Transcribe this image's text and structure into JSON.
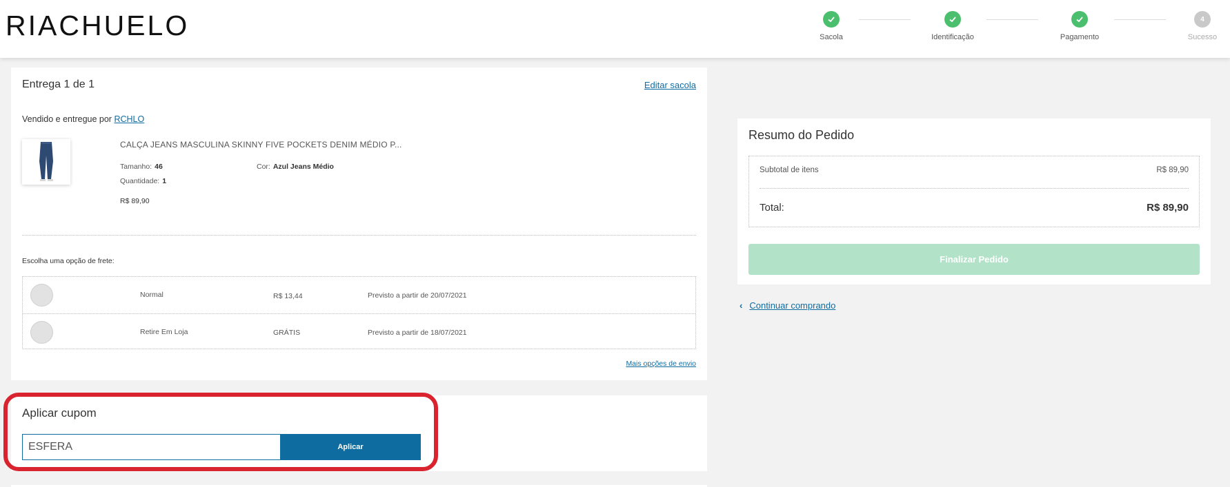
{
  "header": {
    "logo": "RIACHUELO",
    "steps": [
      {
        "label": "Sacola",
        "state": "done"
      },
      {
        "label": "Identificação",
        "state": "done"
      },
      {
        "label": "Pagamento",
        "state": "done"
      },
      {
        "label": "Sucesso",
        "state": "pending",
        "number": "4"
      }
    ]
  },
  "delivery": {
    "title": "Entrega 1 de 1",
    "edit_link": "Editar sacola",
    "seller_prefix": "Vendido e entregue por",
    "seller_link": "RCHLO",
    "product": {
      "name": "CALÇA JEANS MASCULINA SKINNY FIVE POCKETS DENIM MÉDIO P...",
      "size_label": "Tamanho:",
      "size_value": "46",
      "color_label": "Cor:",
      "color_value": "Azul Jeans Médio",
      "qty_label": "Quantidade:",
      "qty_value": "1",
      "price": "R$ 89,90"
    },
    "shipping_label": "Escolha uma opção de frete:",
    "shipping_options": [
      {
        "name": "Normal",
        "price": "R$ 13,44",
        "eta": "Previsto a partir de 20/07/2021"
      },
      {
        "name": "Retire Em Loja",
        "price": "GRÁTIS",
        "eta": "Previsto a partir de 18/07/2021"
      }
    ],
    "more_options": "Mais opções de envio"
  },
  "coupon": {
    "title": "Aplicar cupom",
    "input_value": "ESFERA",
    "button": "Aplicar"
  },
  "summary": {
    "title": "Resumo do Pedido",
    "subtotal_label": "Subtotal de itens",
    "subtotal_value": "R$ 89,90",
    "total_label": "Total:",
    "total_value": "R$ 89,90",
    "finalize_button": "Finalizar Pedido",
    "continue_link": "Continuar comprando"
  },
  "colors": {
    "accent": "#0e6ca1",
    "success": "#4cbf6f",
    "finalize_disabled": "#b2e3c8",
    "highlight": "#d9232e"
  }
}
